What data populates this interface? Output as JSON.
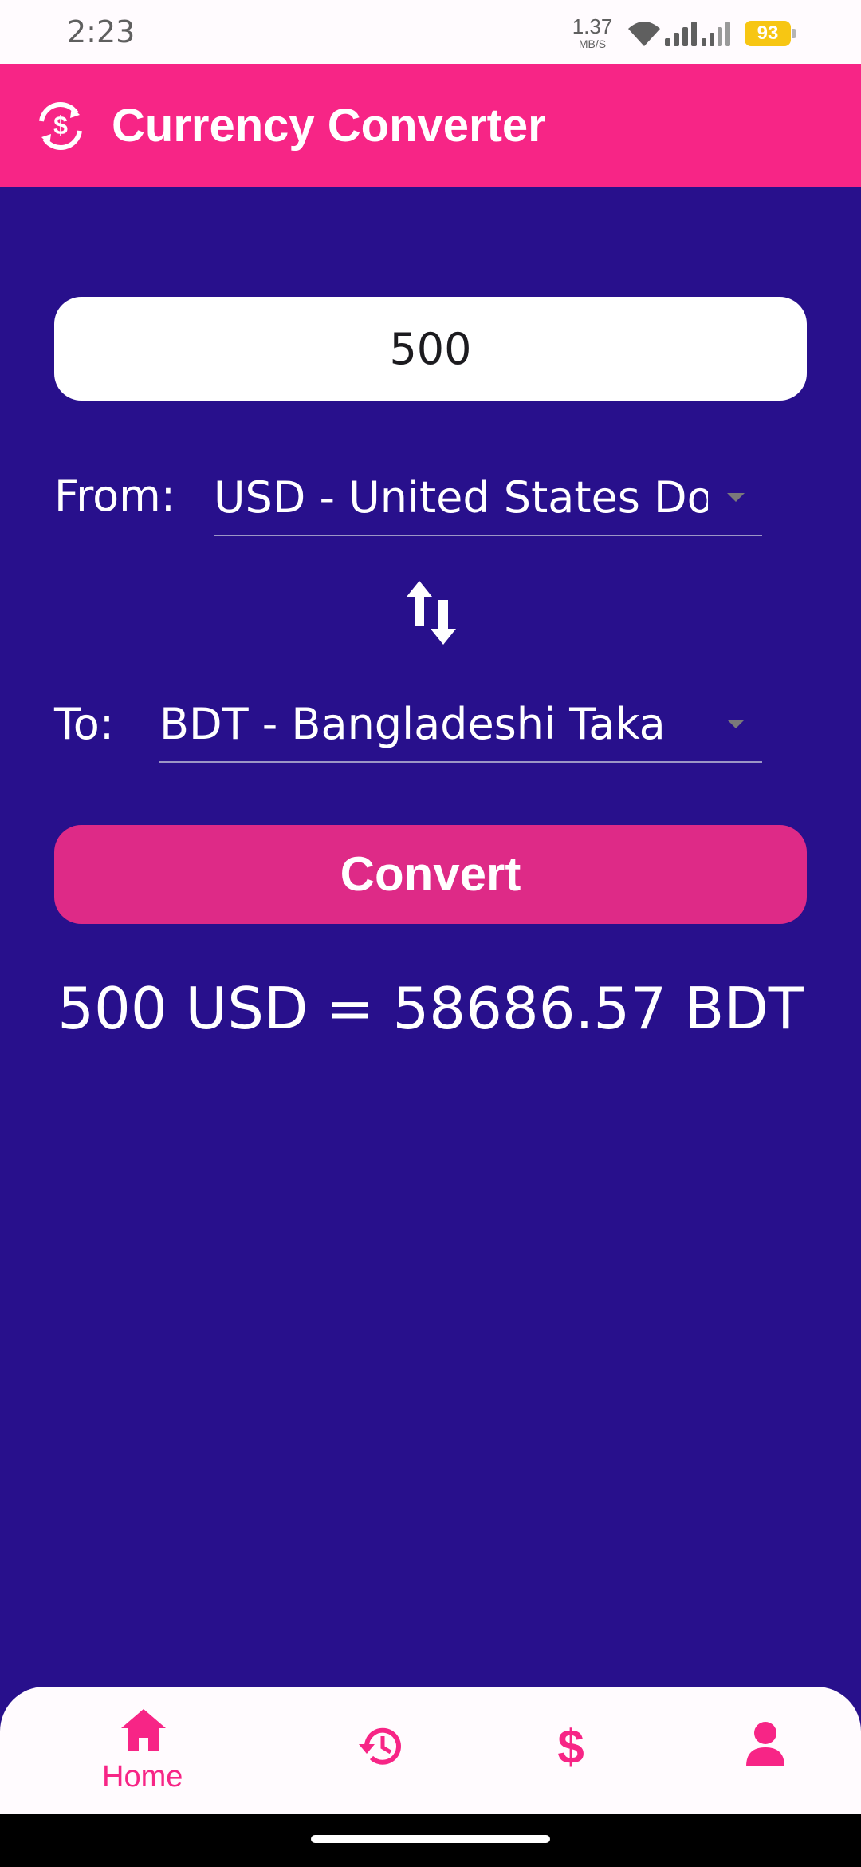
{
  "status_bar": {
    "time": "2:23",
    "net_speed": "1.37",
    "net_unit": "MB/S",
    "battery": "93",
    "icons": [
      "wifi-icon",
      "signal-icon",
      "battery-icon"
    ]
  },
  "app_bar": {
    "title": "Currency Converter",
    "icon": "currency-exchange-icon",
    "color": "#f72586"
  },
  "form": {
    "amount_value": "500",
    "from_label": "From:",
    "from_value": "USD - United States Dol...",
    "to_label": "To:",
    "to_value": "BDT - Bangladeshi Taka",
    "swap_icon": "swap-vertical-icon",
    "convert_label": "Convert"
  },
  "result": {
    "text": "500 USD = 58686.57 BDT"
  },
  "bottom_nav": {
    "items": [
      {
        "label": "Home",
        "icon": "home-icon",
        "selected": true
      },
      {
        "label": "",
        "icon": "history-icon",
        "selected": false
      },
      {
        "label": "",
        "icon": "dollar-icon",
        "selected": false
      },
      {
        "label": "",
        "icon": "person-icon",
        "selected": false
      }
    ]
  },
  "colors": {
    "background": "#28108c",
    "accent": "#f72586",
    "button": "#de2a87"
  }
}
